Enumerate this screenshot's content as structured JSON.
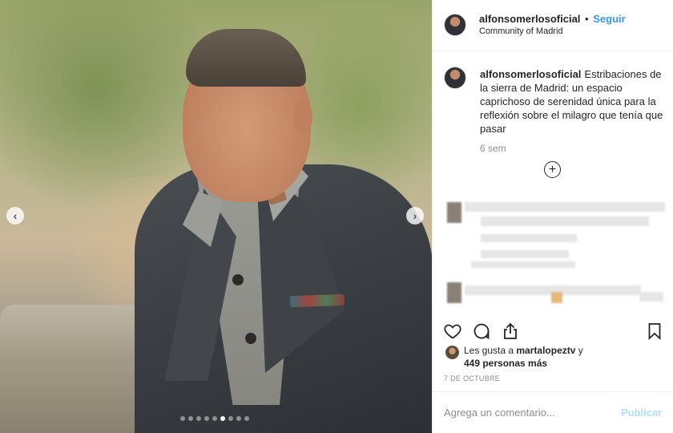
{
  "post": {
    "photo": {
      "carousel_count": 9,
      "carousel_active_index": 5
    },
    "header": {
      "username": "alfonsomerlosoficial",
      "separator": "•",
      "follow_label": "Seguir",
      "location": "Community of Madrid"
    },
    "caption": {
      "username": "alfonsomerlosoficial",
      "text": "Estribaciones de la sierra de Madrid: un espacio caprichoso de serenidad única para la reflexión sobre el milagro que tenía que pasar",
      "time": "6 sem",
      "more_icon": "+"
    },
    "likes": {
      "prefix": "Les gusta a",
      "liker": "martalopeztv",
      "suffix": "y",
      "others": "449 personas más"
    },
    "date": "7 DE OCTUBRE",
    "comment": {
      "placeholder": "Agrega un comentario...",
      "publish_label": "Publicar"
    },
    "icons": {
      "like": "heart-icon",
      "comment": "comment-icon",
      "share": "share-icon",
      "save": "bookmark-icon",
      "prev": "chevron-left-icon",
      "next": "chevron-right-icon"
    },
    "colors": {
      "follow": "#3897f0",
      "publish_disabled": "#b2dffc",
      "muted": "#8e8e8e",
      "text": "#262626"
    }
  }
}
